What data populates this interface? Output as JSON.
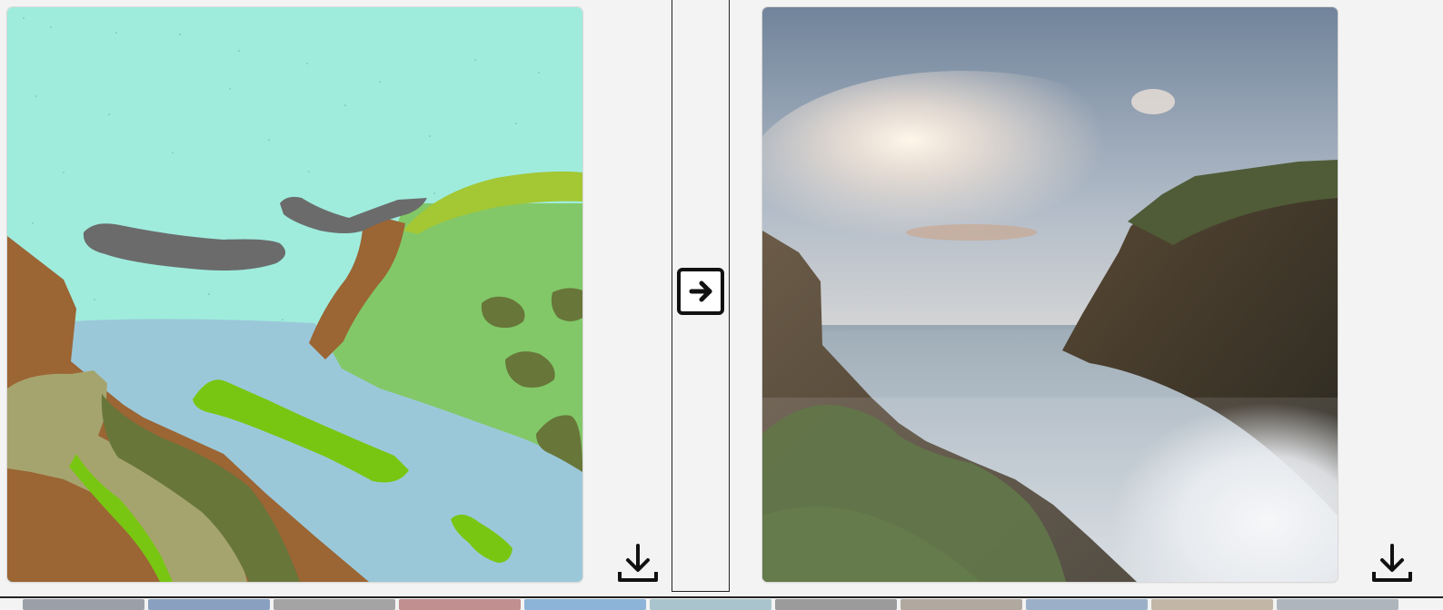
{
  "sketch": {
    "name": "sketch-canvas",
    "background_color": "#9fecdd",
    "region_colors": {
      "sky": "#9fecdd",
      "water": "#9bc8d9",
      "cliff": "#9b6534",
      "grass": "#82c868",
      "hill_top": "#a4c734",
      "cloud": "#6b6b6b",
      "shrub": "#68763a",
      "sand": "#a6a46e",
      "bright_green": "#79c612"
    }
  },
  "output": {
    "name": "generated-landscape-image",
    "colors": {
      "sky_top": "#7d8ea3",
      "sky_glow": "#f3e6d8",
      "sea": "#b7c3ca",
      "fog": "#e5e8eb",
      "cliff_dark": "#3f382b",
      "vegetation": "#4a6030"
    }
  },
  "actions": {
    "convert_icon": "arrow-right-boxed",
    "download_icon": "download-tray-arrow"
  },
  "thumbnails": [
    {
      "color": "#9ba0a8"
    },
    {
      "color": "#8aa0c0"
    },
    {
      "color": "#a4a4a4"
    },
    {
      "color": "#c08f8f"
    },
    {
      "color": "#8cb3d8"
    },
    {
      "color": "#a9c4cc"
    },
    {
      "color": "#9b9b9b"
    },
    {
      "color": "#b1a9a0"
    },
    {
      "color": "#9bb0c8"
    },
    {
      "color": "#c2b7a7"
    },
    {
      "color": "#aeb5bc"
    }
  ]
}
